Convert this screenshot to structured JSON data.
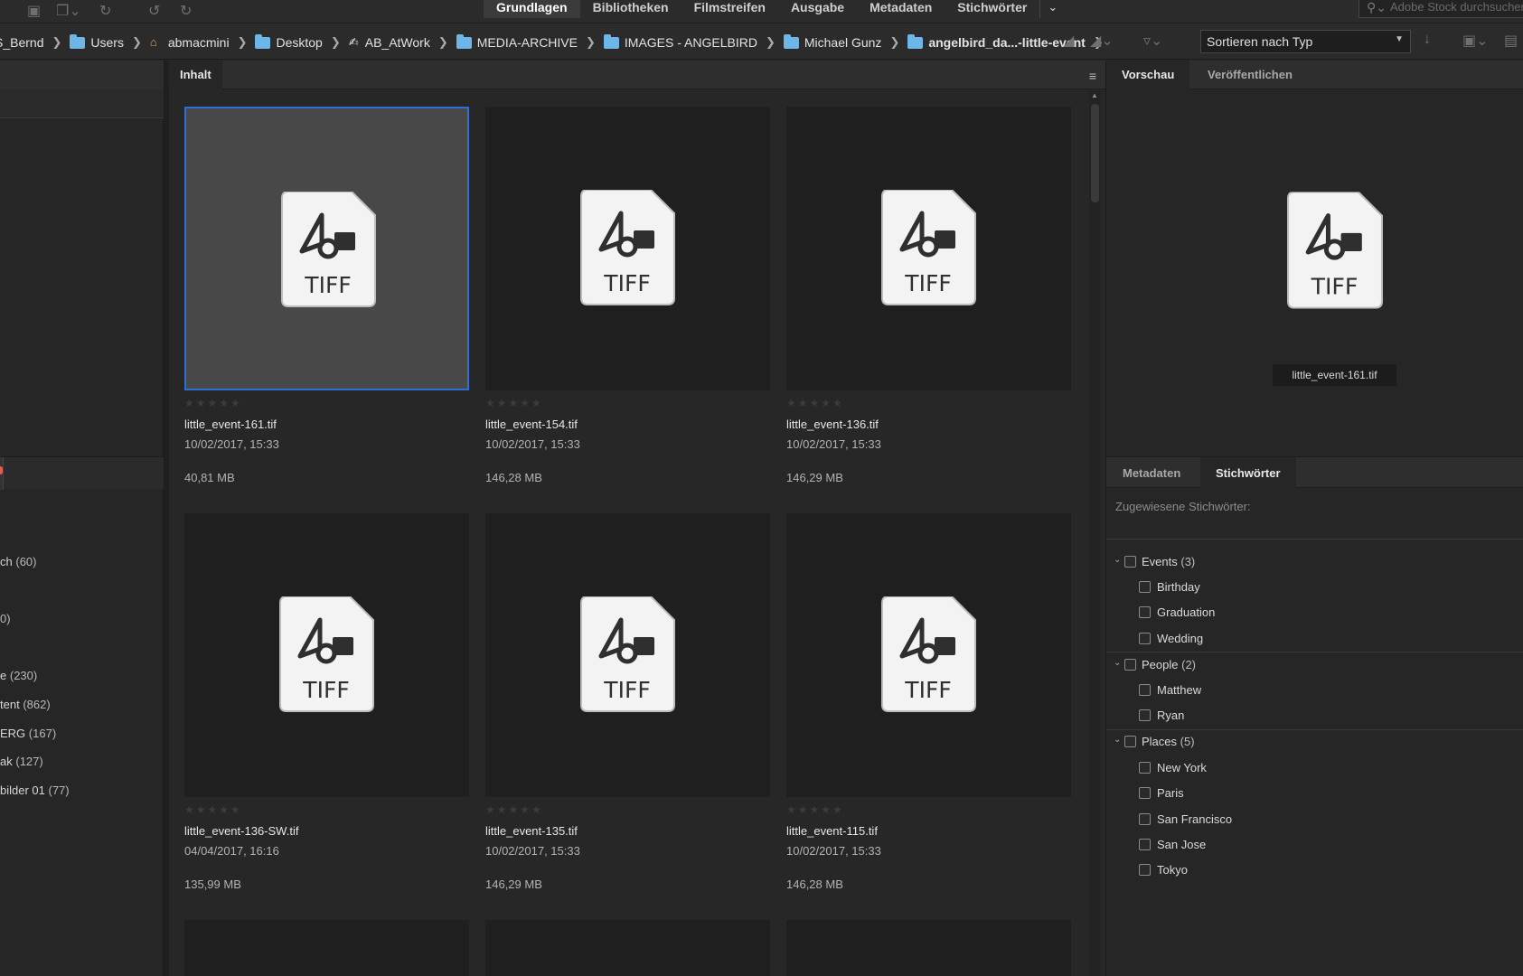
{
  "workspace_tabs": [
    {
      "label": "Grundlagen",
      "active": true
    },
    {
      "label": "Bibliotheken",
      "active": false
    },
    {
      "label": "Filmstreifen",
      "active": false
    },
    {
      "label": "Ausgabe",
      "active": false
    },
    {
      "label": "Metadaten",
      "active": false
    },
    {
      "label": "Stichwörter",
      "active": false
    }
  ],
  "stock_search": {
    "placeholder": "Adobe Stock durchsuchen"
  },
  "breadcrumbs": [
    {
      "label": "S_Bernd",
      "icon": "none",
      "bold": false
    },
    {
      "label": "Users",
      "icon": "folder-icon",
      "bold": false
    },
    {
      "label": "abmacmini",
      "icon": "home-icon",
      "bold": false
    },
    {
      "label": "Desktop",
      "icon": "folder-icon",
      "bold": false
    },
    {
      "label": "AB_AtWork",
      "icon": "user-folder-icon",
      "bold": false
    },
    {
      "label": "MEDIA-ARCHIVE",
      "icon": "folder-icon",
      "bold": false
    },
    {
      "label": "IMAGES - ANGELBIRD",
      "icon": "folder-icon",
      "bold": false
    },
    {
      "label": "Michael Gunz",
      "icon": "folder-icon",
      "bold": false
    },
    {
      "label": "angelbird_da...-little-event",
      "icon": "folder-icon",
      "bold": true
    }
  ],
  "sort": {
    "label": "Sortieren nach Typ"
  },
  "left_collections": [
    {
      "label": "",
      "count": "",
      "prefix": "dot"
    },
    {
      "label": "ch",
      "count": "(60)"
    },
    {
      "label": "",
      "count": "0)"
    },
    {
      "label": "e",
      "count": "(230)"
    },
    {
      "label": "tent",
      "count": "(862)"
    },
    {
      "label": "ERG",
      "count": "(167)"
    },
    {
      "label": "ak",
      "count": "(127)"
    },
    {
      "label": "bilder 01",
      "count": "(77)"
    }
  ],
  "content": {
    "tab_label": "Inhalt",
    "files": [
      {
        "name": "little_event-161.tif",
        "date": "10/02/2017, 15:33",
        "size": "40,81 MB",
        "selected": true
      },
      {
        "name": "little_event-154.tif",
        "date": "10/02/2017, 15:33",
        "size": "146,28 MB",
        "selected": false
      },
      {
        "name": "little_event-136.tif",
        "date": "10/02/2017, 15:33",
        "size": "146,29 MB",
        "selected": false
      },
      {
        "name": "little_event-136-SW.tif",
        "date": "04/04/2017, 16:16",
        "size": "135,99 MB",
        "selected": false
      },
      {
        "name": "little_event-135.tif",
        "date": "10/02/2017, 15:33",
        "size": "146,29 MB",
        "selected": false
      },
      {
        "name": "little_event-115.tif",
        "date": "10/02/2017, 15:33",
        "size": "146,28 MB",
        "selected": false
      }
    ],
    "tiff_label": "TIFF"
  },
  "preview": {
    "tabs": [
      {
        "label": "Vorschau"
      },
      {
        "label": "Veröffentlichen"
      }
    ],
    "file_label": "little_event-161.tif",
    "tiff_label": "TIFF"
  },
  "metadata_panel": {
    "tabs": [
      {
        "label": "Metadaten"
      },
      {
        "label": "Stichwörter"
      }
    ],
    "assigned_label": "Zugewiesene Stichwörter:"
  },
  "keywords": [
    {
      "label": "Events",
      "count": "(3)",
      "level": 0
    },
    {
      "label": "Birthday",
      "count": "",
      "level": 1
    },
    {
      "label": "Graduation",
      "count": "",
      "level": 1
    },
    {
      "label": "Wedding",
      "count": "",
      "level": 1
    },
    {
      "label": "People",
      "count": "(2)",
      "level": 0
    },
    {
      "label": "Matthew",
      "count": "",
      "level": 1
    },
    {
      "label": "Ryan",
      "count": "",
      "level": 1
    },
    {
      "label": "Places",
      "count": "(5)",
      "level": 0
    },
    {
      "label": "New York",
      "count": "",
      "level": 1
    },
    {
      "label": "Paris",
      "count": "",
      "level": 1
    },
    {
      "label": "San Francisco",
      "count": "",
      "level": 1
    },
    {
      "label": "San Jose",
      "count": "",
      "level": 1
    },
    {
      "label": "Tokyo",
      "count": "",
      "level": 1
    }
  ],
  "colors": {
    "accent": "#2f6fd3",
    "folder": "#6fb6e8",
    "background": "#262626"
  }
}
